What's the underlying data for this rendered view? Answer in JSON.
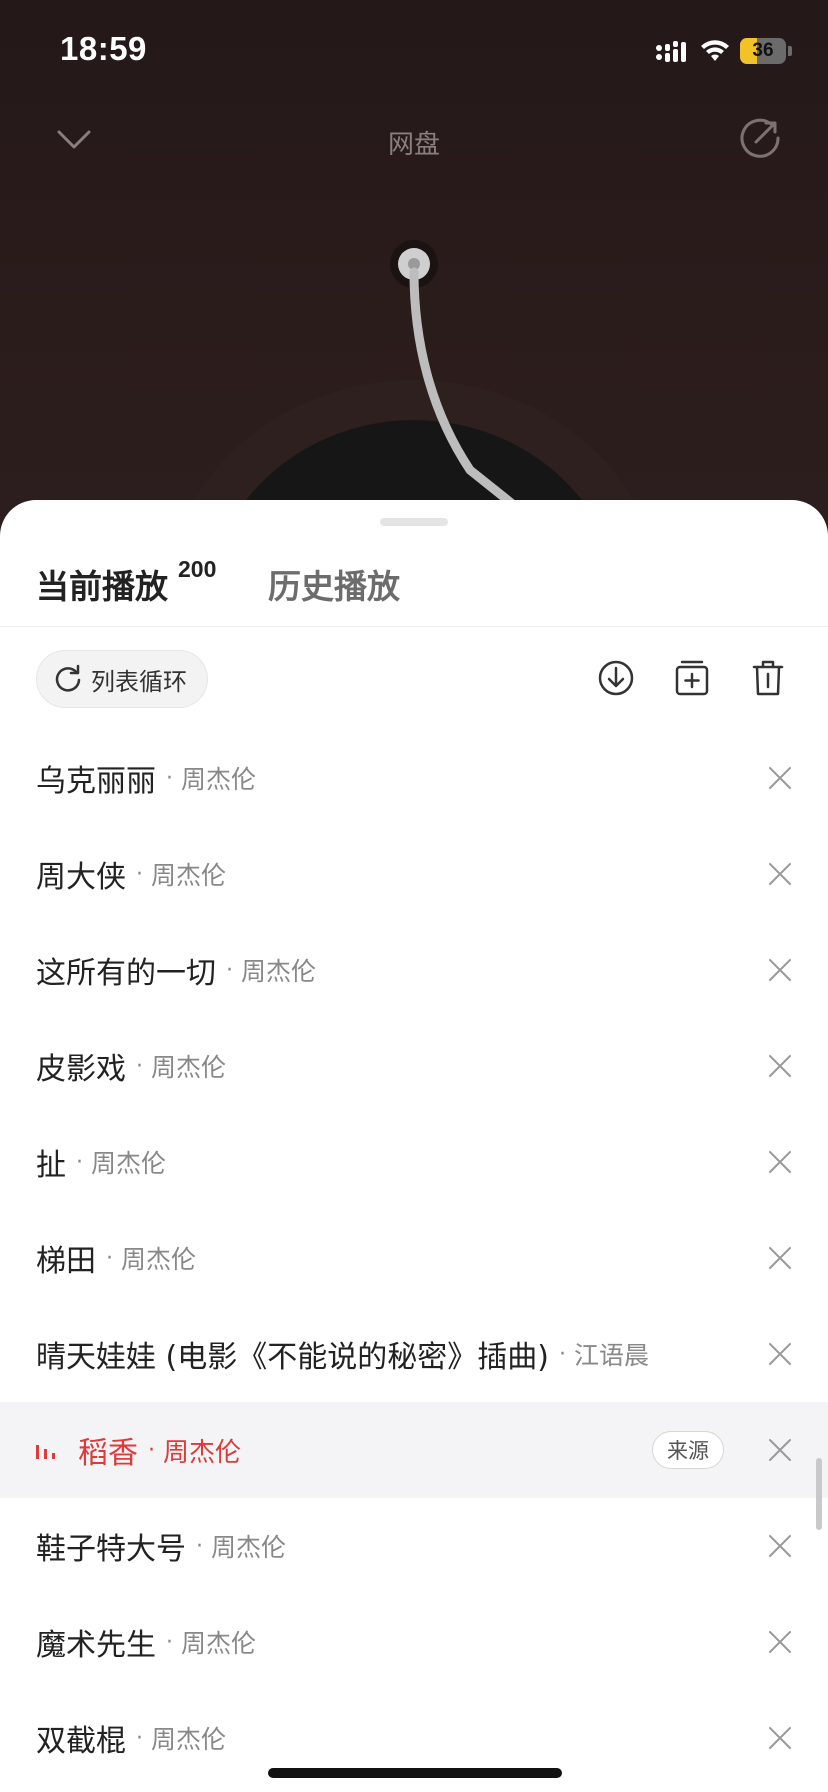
{
  "status_bar": {
    "time": "18:59",
    "battery_level": "36",
    "battery_fraction": 0.36,
    "icons": [
      "signal-icon",
      "wifi-icon",
      "battery-icon"
    ]
  },
  "player": {
    "title": "网盘",
    "icons": [
      "chevron-down-icon",
      "share-icon"
    ]
  },
  "sheet": {
    "tabs": {
      "current_label": "当前播放",
      "current_count": "200",
      "history_label": "历史播放"
    },
    "toolbar": {
      "loop_mode_label": "列表循环",
      "icons": [
        "repeat-icon",
        "download-icon",
        "add-to-playlist-icon",
        "trash-icon"
      ]
    },
    "songs": [
      {
        "title": "乌克丽丽",
        "sep": "·",
        "artist": "周杰伦"
      },
      {
        "title": "周大侠",
        "sep": "·",
        "artist": "周杰伦"
      },
      {
        "title": "这所有的一切",
        "sep": "·",
        "artist": "周杰伦"
      },
      {
        "title": "皮影戏",
        "sep": "·",
        "artist": "周杰伦"
      },
      {
        "title": "扯",
        "sep": "·",
        "artist": "周杰伦"
      },
      {
        "title": "梯田",
        "sep": "·",
        "artist": "周杰伦"
      },
      {
        "title": "晴天娃娃 (电影《不能说的秘密》插曲)",
        "sep": "·",
        "artist": "江语晨"
      },
      {
        "title": "稻香",
        "sep": "·",
        "artist": "周杰伦",
        "playing": true,
        "badge": "来源"
      },
      {
        "title": "鞋子特大号",
        "sep": "·",
        "artist": "周杰伦"
      },
      {
        "title": "魔术先生",
        "sep": "·",
        "artist": "周杰伦"
      },
      {
        "title": "双截棍",
        "sep": "·",
        "artist": "周杰伦"
      }
    ]
  },
  "colors": {
    "accent_playing": "#de3a3a",
    "player_background": "#2a1b1b",
    "battery_fill": "#f2c227"
  }
}
